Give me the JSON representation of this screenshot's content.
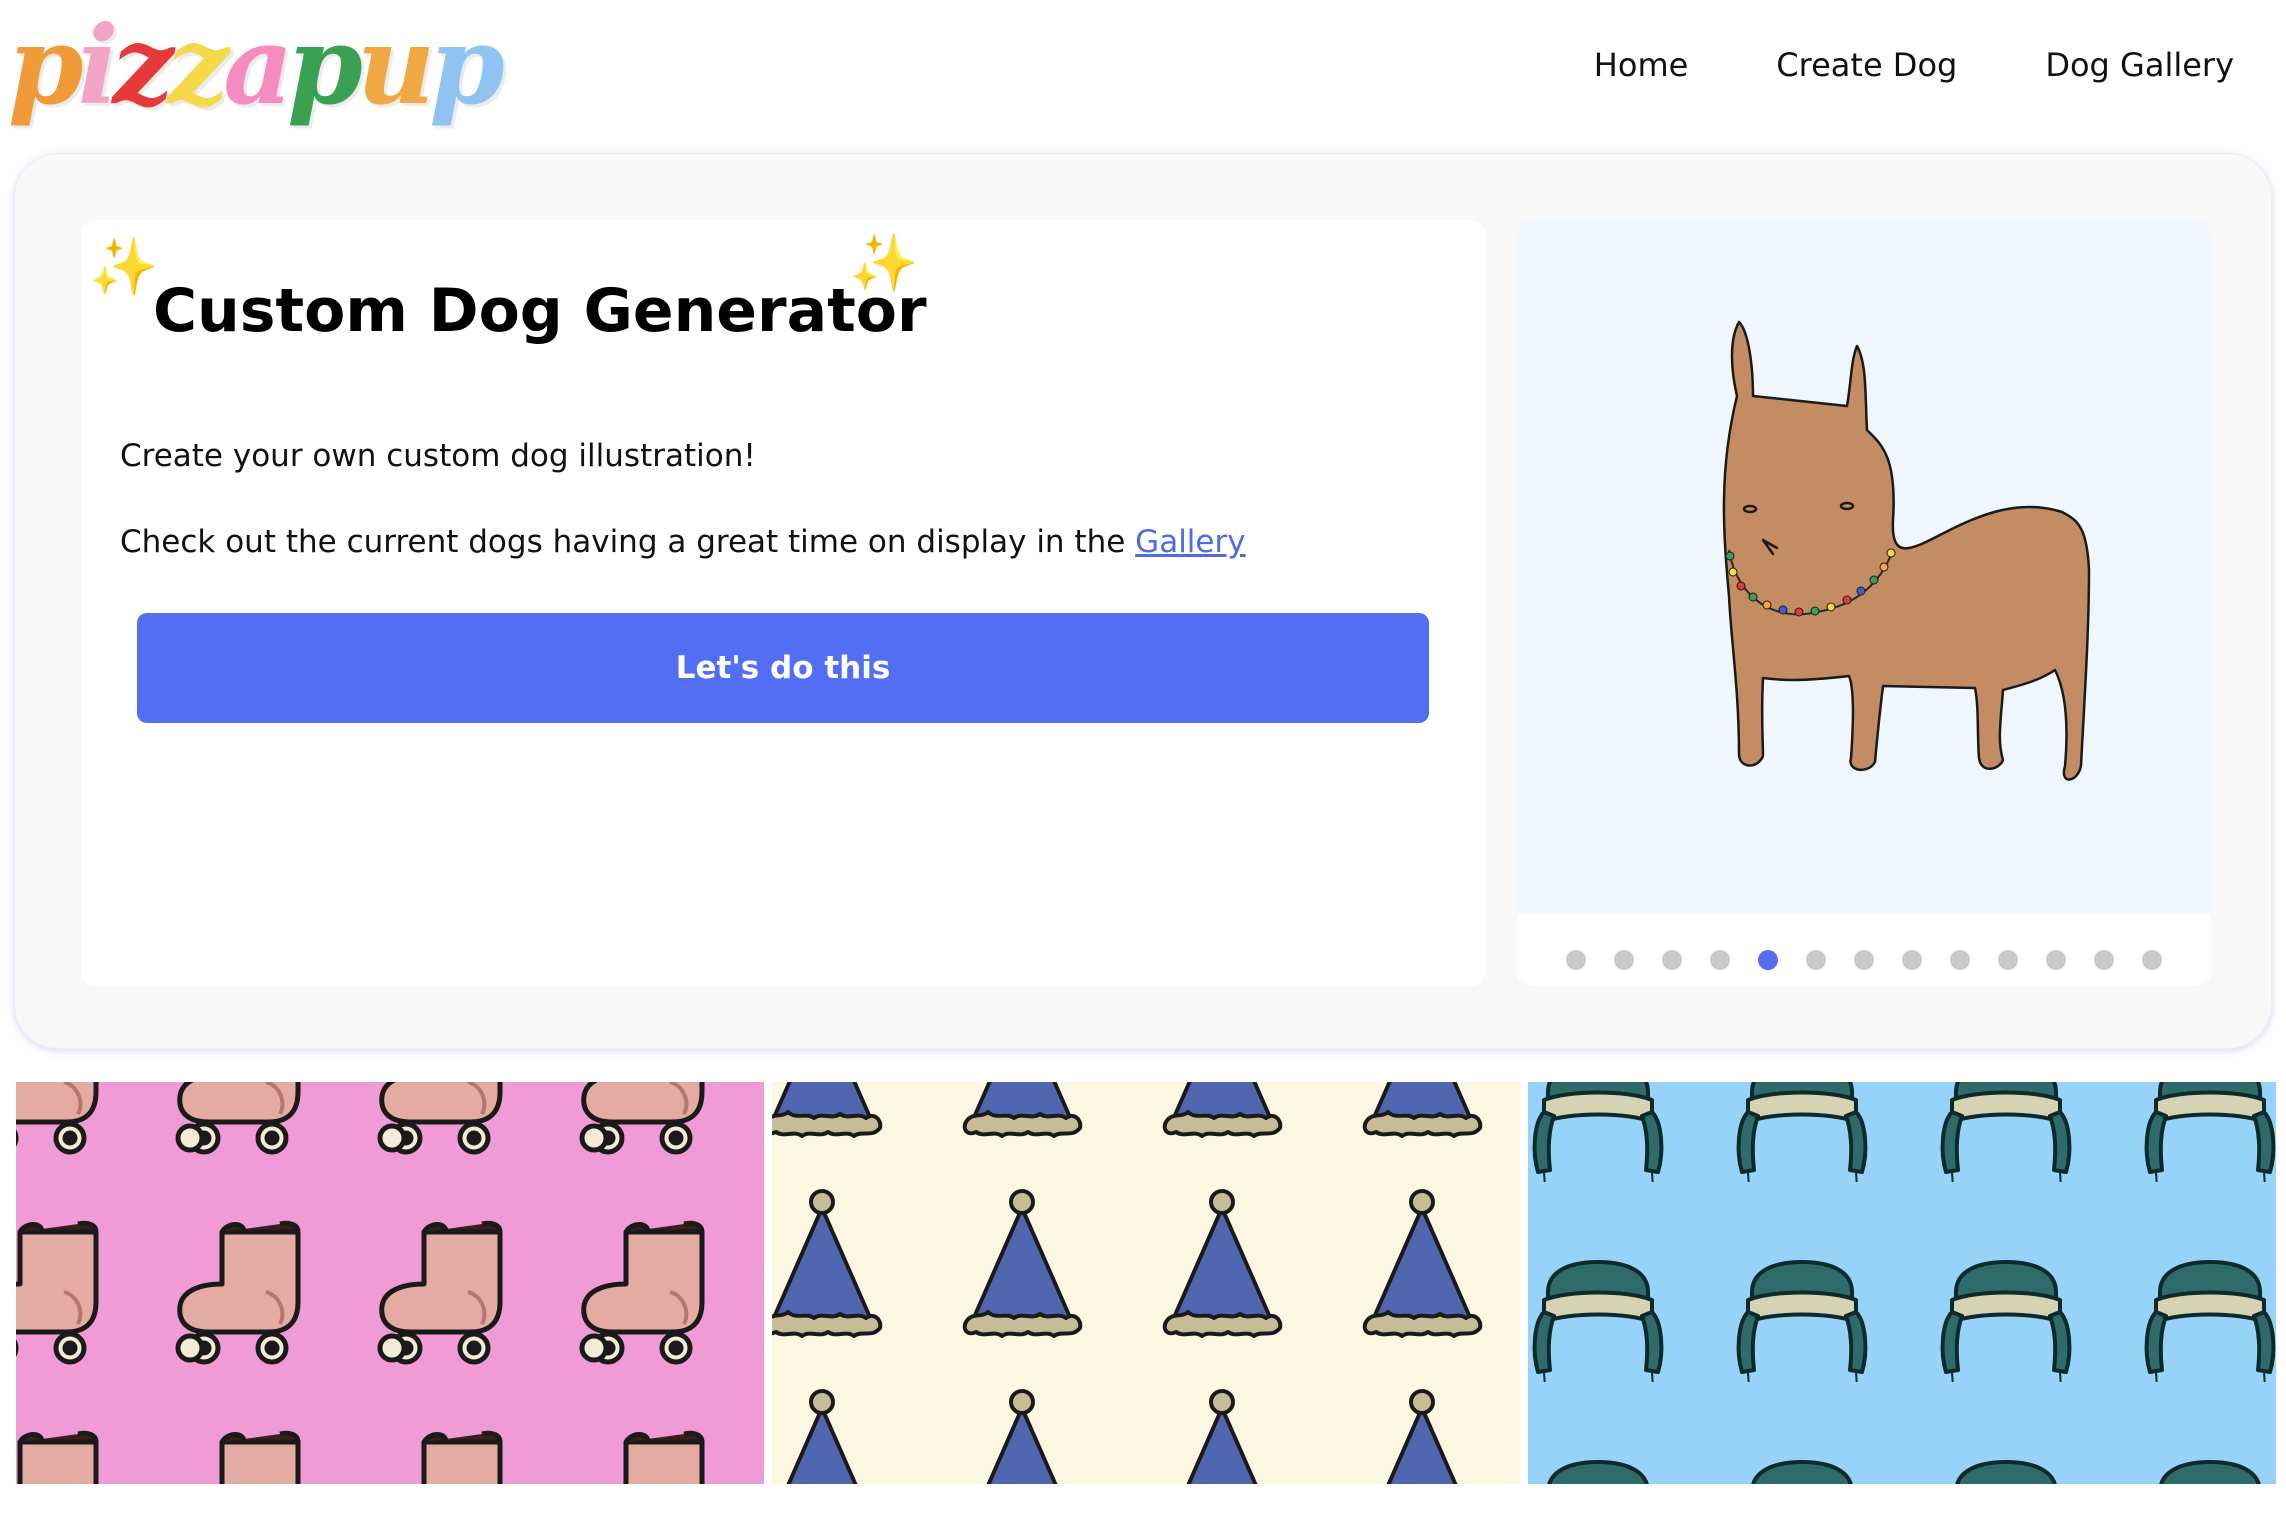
{
  "header": {
    "logo_letters": [
      {
        "ch": "p",
        "color": "#f09a3a"
      },
      {
        "ch": "i",
        "color": "#f2a4c4"
      },
      {
        "ch": "z",
        "color": "#e63a3a"
      },
      {
        "ch": "z",
        "color": "#f6d94b"
      },
      {
        "ch": "a",
        "color": "#f48cbf"
      },
      {
        "ch": "p",
        "color": "#3aa153"
      },
      {
        "ch": "u",
        "color": "#f0a845"
      },
      {
        "ch": "p",
        "color": "#8fc3f2"
      }
    ],
    "nav": {
      "home": "Home",
      "create_dog": "Create Dog",
      "dog_gallery": "Dog Gallery"
    }
  },
  "hero": {
    "title": "Custom Dog Generator",
    "intro": "Create your own custom dog illustration!",
    "gallery_text": "Check out the current dogs having a great time on display in the ",
    "gallery_link": "Gallery",
    "cta_label": "Let's do this"
  },
  "carousel": {
    "dot_count": 13,
    "active_index": 4
  },
  "tiles": [
    {
      "name": "roller-skates",
      "background": "#f19bd6"
    },
    {
      "name": "party-hats",
      "background": "#fcf7e1"
    },
    {
      "name": "trapper-hats",
      "background": "#97d2f9"
    }
  ],
  "colors": {
    "accent": "#526ef3",
    "dog_body": "#c48c62",
    "slide_bg": "#f0f6fd"
  }
}
